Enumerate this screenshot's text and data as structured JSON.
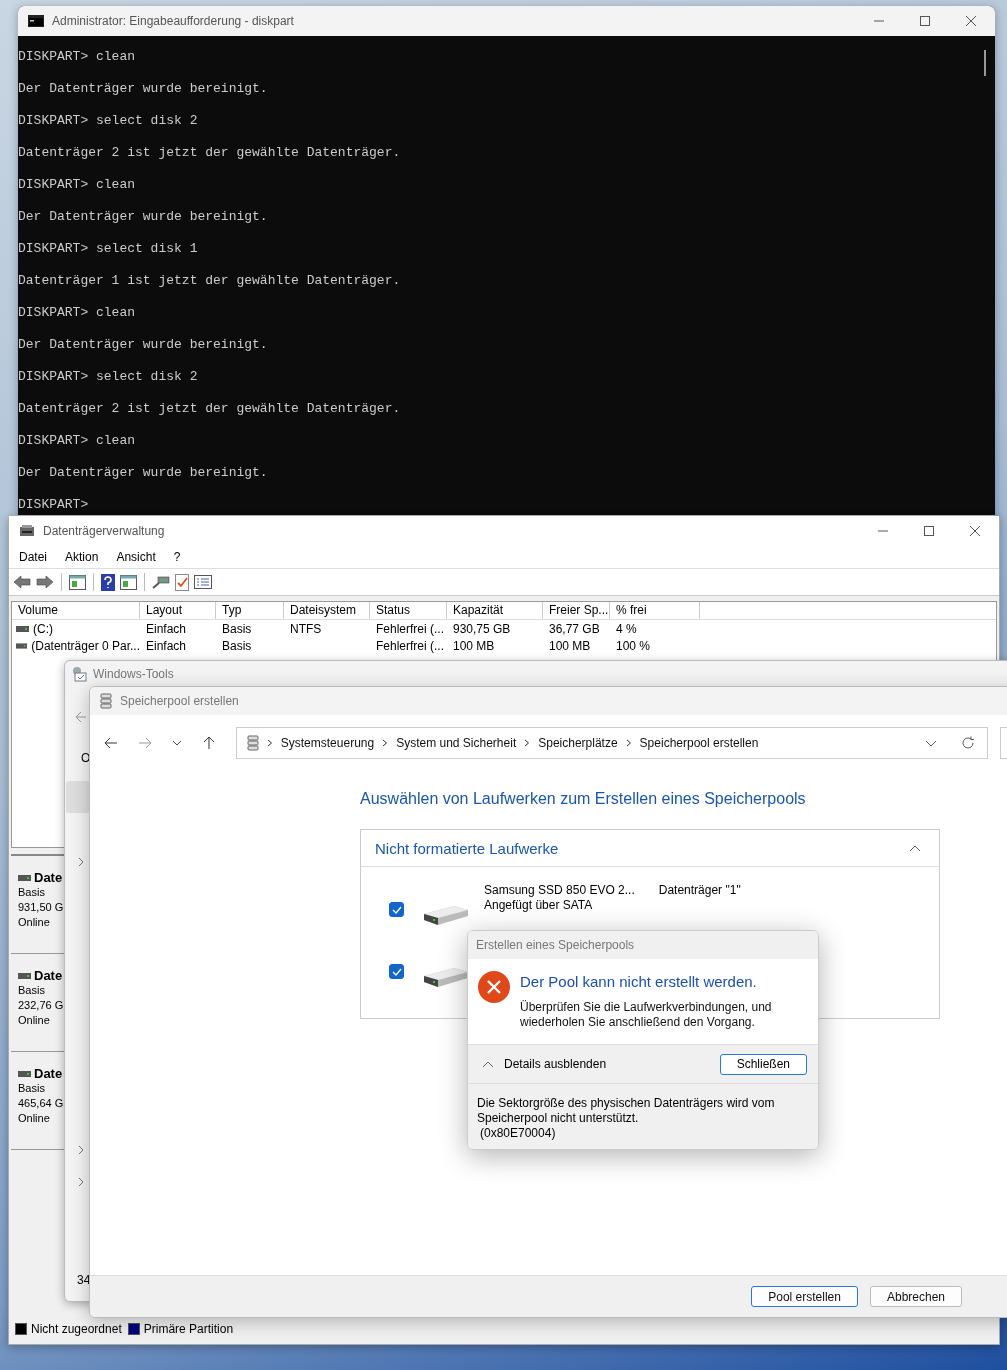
{
  "terminal": {
    "title": "Administrator: Eingabeaufforderung - diskpart",
    "lines": [
      "DISKPART> clean",
      "Der Datenträger wurde bereinigt.",
      "DISKPART> select disk 2",
      "Datenträger 2 ist jetzt der gewählte Datenträger.",
      "DISKPART> clean",
      "Der Datenträger wurde bereinigt.",
      "DISKPART> select disk 1",
      "Datenträger 1 ist jetzt der gewählte Datenträger.",
      "DISKPART> clean",
      "Der Datenträger wurde bereinigt.",
      "DISKPART> select disk 2",
      "Datenträger 2 ist jetzt der gewählte Datenträger.",
      "DISKPART> clean",
      "Der Datenträger wurde bereinigt.",
      "DISKPART>"
    ]
  },
  "disk_management": {
    "title": "Datenträgerverwaltung",
    "menu": [
      "Datei",
      "Aktion",
      "Ansicht",
      "?"
    ],
    "table": {
      "columns": [
        "Volume",
        "Layout",
        "Typ",
        "Dateisystem",
        "Status",
        "Kapazität",
        "Freier Sp...",
        "% frei"
      ],
      "rows": [
        {
          "volume": "(C:)",
          "layout": "Einfach",
          "type": "Basis",
          "file_system": "NTFS",
          "status": "Fehlerfrei (...",
          "capacity": "930,75 GB",
          "free_space": "36,77 GB",
          "percent_free": "4 %"
        },
        {
          "volume": "(Datenträger 0 Par...",
          "layout": "Einfach",
          "type": "Basis",
          "status": "Fehlerfrei (...",
          "capacity": "100 MB",
          "free_space": "100 MB",
          "percent_free": "100 %"
        }
      ]
    },
    "disks": [
      {
        "name": "Date",
        "type": "Basis",
        "size": "931,50 G",
        "status": "Online"
      },
      {
        "name": "Date",
        "type": "Basis",
        "size": "232,76 G",
        "status": "Online"
      },
      {
        "name": "Date",
        "type": "Basis",
        "size": "465,64 G",
        "status": "Online"
      }
    ],
    "legend": [
      {
        "label": "Nicht zugeordnet",
        "color": "#000000"
      },
      {
        "label": "Primäre Partition",
        "color": "#000080"
      }
    ]
  },
  "tools_window": {
    "title": "Windows-Tools",
    "nav_letter": "O",
    "footer_text": "34"
  },
  "pool_window": {
    "title": "Speicherpool erstellen",
    "breadcrumb": [
      "Systemsteuerung",
      "System und Sicherheit",
      "Speicherplätze",
      "Speicherpool erstellen"
    ],
    "heading": "Auswählen von Laufwerken zum Erstellen eines Speicherpools",
    "section": {
      "title": "Nicht formatierte Laufwerke",
      "expanded": true
    },
    "drives": [
      {
        "name": "Samsung SSD 850 EVO 2...",
        "disk": "Datenträger \"1\"",
        "connection": "Angefügt über SATA",
        "checked": true
      },
      {
        "checked": true
      }
    ],
    "buttons": [
      {
        "label": "Pool erstellen",
        "kind": "default"
      },
      {
        "label": "Abbrechen",
        "kind": "normal"
      }
    ]
  },
  "error_dialog": {
    "title": "Erstellen eines Speicherpools",
    "message": "Der Pool kann nicht erstellt werden.",
    "hint": "Überprüfen Sie die Laufwerkverbindungen, und wiederholen Sie anschließend den Vorgang.",
    "details_toggle": {
      "label": "Details ausblenden",
      "expanded": true
    },
    "close_button": "Schließen",
    "details": [
      "Die Sektorgröße des physischen Datenträgers wird vom Speicherpool nicht unterstützt.",
      "(0x80E70004)"
    ]
  }
}
